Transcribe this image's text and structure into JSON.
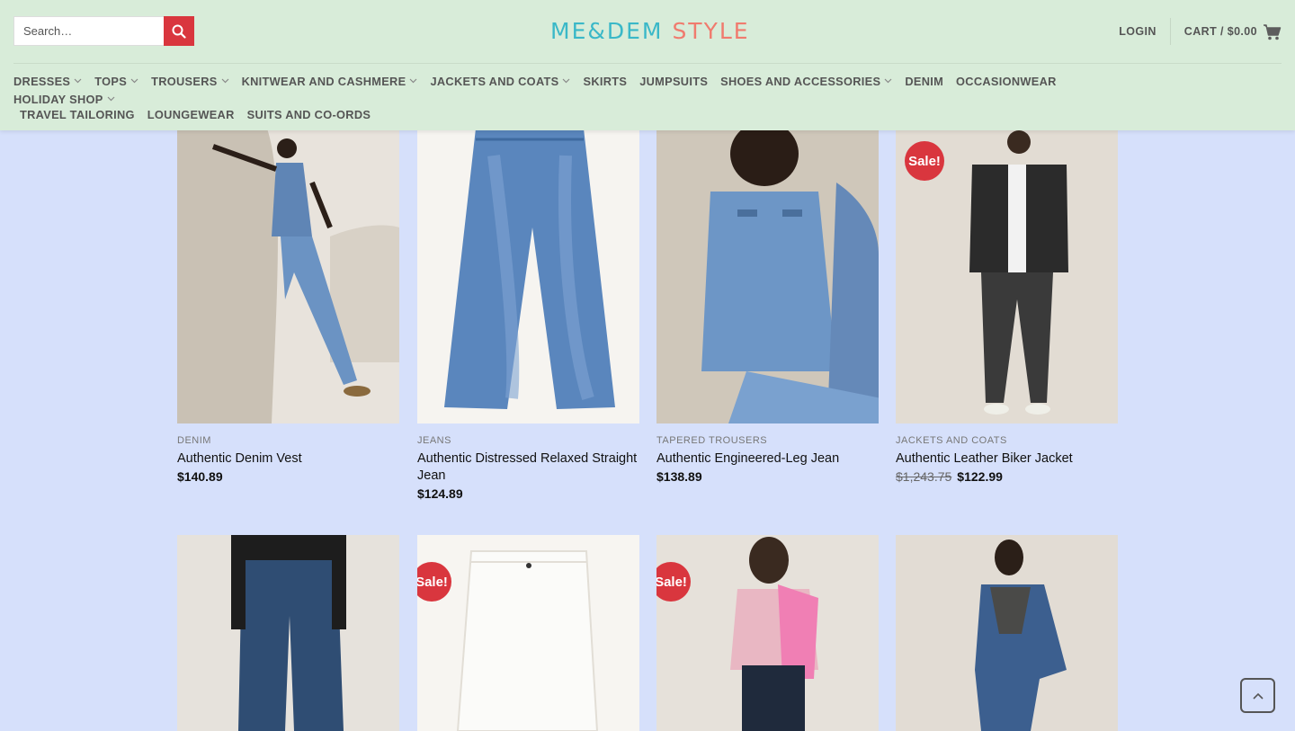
{
  "header": {
    "search_placeholder": "Search…",
    "logo_part1": "ME&DEM",
    "logo_part2": "STYLE",
    "login": "LOGIN",
    "cart": "CART / $0.00"
  },
  "nav": {
    "row1": [
      {
        "label": "DRESSES",
        "dropdown": true
      },
      {
        "label": "TOPS",
        "dropdown": true
      },
      {
        "label": "TROUSERS",
        "dropdown": true
      },
      {
        "label": "KNITWEAR AND CASHMERE",
        "dropdown": true
      },
      {
        "label": "JACKETS AND COATS",
        "dropdown": true
      },
      {
        "label": "SKIRTS",
        "dropdown": false
      },
      {
        "label": "JUMPSUITS",
        "dropdown": false
      },
      {
        "label": "SHOES AND ACCESSORIES",
        "dropdown": true
      },
      {
        "label": "DENIM",
        "dropdown": false
      },
      {
        "label": "OCCASIONWEAR",
        "dropdown": false
      },
      {
        "label": "HOLIDAY SHOP",
        "dropdown": true
      }
    ],
    "row2": [
      {
        "label": "TRAVEL TAILORING"
      },
      {
        "label": "LOUNGEWEAR"
      },
      {
        "label": "SUITS AND CO-ORDS"
      }
    ]
  },
  "products": [
    {
      "category": "DENIM",
      "title": "Authentic Denim Vest",
      "price": "$140.89",
      "old_price": "",
      "sale": ""
    },
    {
      "category": "JEANS",
      "title": "Authentic Distressed Relaxed Straight Jean",
      "price": "$124.89",
      "old_price": "",
      "sale": ""
    },
    {
      "category": "TAPERED TROUSERS",
      "title": "Authentic Engineered-Leg Jean",
      "price": "$138.89",
      "old_price": "",
      "sale": ""
    },
    {
      "category": "JACKETS AND COATS",
      "title": "Authentic Leather Biker Jacket",
      "price": "$122.99",
      "old_price": "$1,243.75",
      "sale": "Sale!"
    },
    {
      "sale": ""
    },
    {
      "sale": "Sale!"
    },
    {
      "sale": "Sale!"
    },
    {
      "sale": ""
    }
  ],
  "colors": {
    "header_bg": "#d8ecd9",
    "page_bg": "#d6e0fb",
    "accent_red": "#d9363e",
    "logo_teal": "#3ab8c8",
    "logo_coral": "#f07b6e"
  }
}
